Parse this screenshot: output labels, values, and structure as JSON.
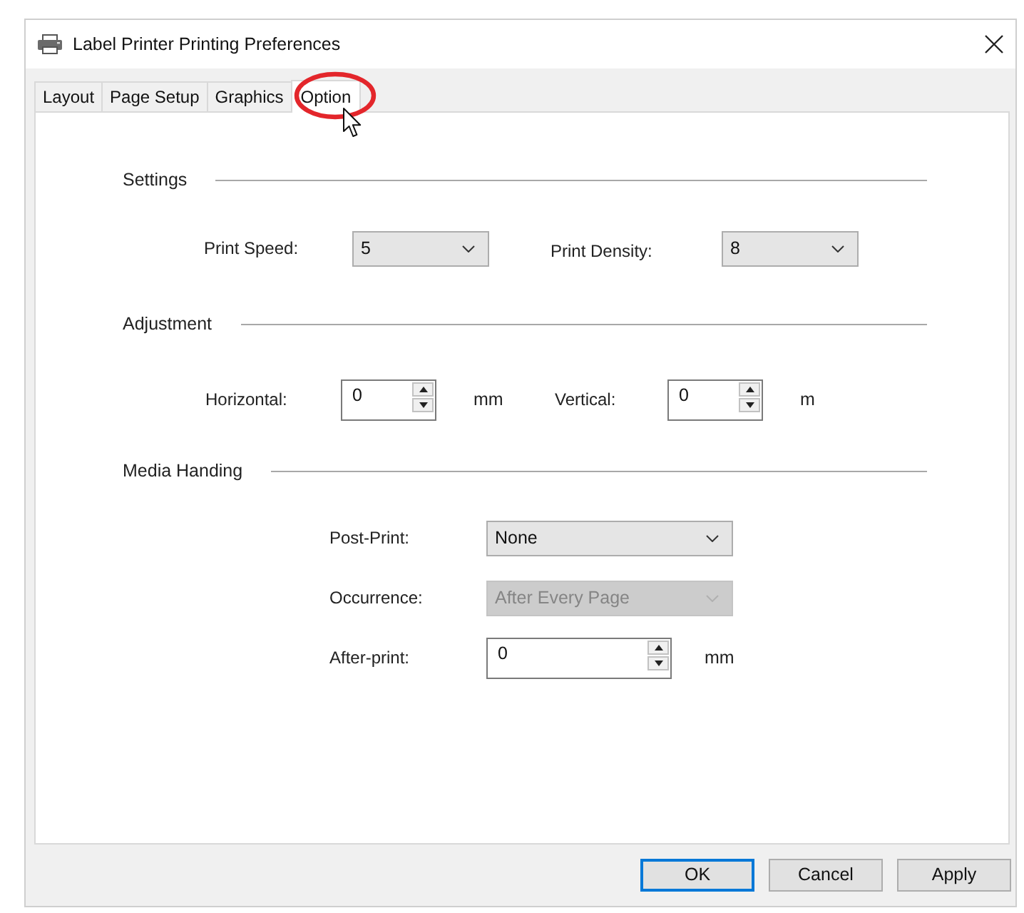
{
  "window": {
    "title": "Label Printer Printing Preferences"
  },
  "tabs": [
    {
      "label": "Layout",
      "selected": false
    },
    {
      "label": "Page Setup",
      "selected": false
    },
    {
      "label": "Graphics",
      "selected": false
    },
    {
      "label": "Option",
      "selected": true
    }
  ],
  "sections": [
    {
      "heading": "Settings",
      "rows": [
        [
          {
            "kind": "dropdown",
            "label": "Print Speed:",
            "value": "5",
            "disabled": false
          },
          {
            "kind": "dropdown",
            "label": "Print Density:",
            "value": "8",
            "disabled": false
          }
        ]
      ]
    },
    {
      "heading": "Adjustment",
      "rows": [
        [
          {
            "kind": "spin",
            "label": "Horizontal:",
            "value": "0",
            "unit": "mm",
            "disabled": false
          },
          {
            "kind": "spin",
            "label": "Vertical:",
            "value": "0",
            "unit": "m",
            "disabled": false
          }
        ]
      ]
    },
    {
      "heading": "Media Handing",
      "rows": [
        [
          {
            "kind": "dropdown",
            "label": "Post-Print:",
            "value": "None",
            "disabled": false
          }
        ],
        [
          {
            "kind": "dropdown",
            "label": "Occurrence:",
            "value": "After Every Page",
            "disabled": true
          }
        ],
        [
          {
            "kind": "spin",
            "label": "After-print:",
            "value": "0",
            "unit": "mm",
            "disabled": false
          }
        ]
      ]
    }
  ],
  "buttons": [
    {
      "label": "OK",
      "default": true
    },
    {
      "label": "Cancel",
      "default": false
    },
    {
      "label": "Apply",
      "default": false
    }
  ]
}
